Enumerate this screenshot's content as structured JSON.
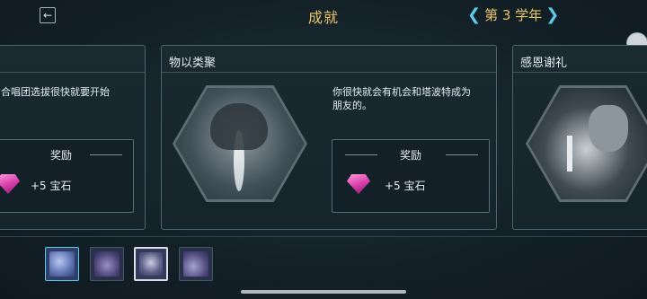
{
  "header": {
    "back_icon": "back-arrow-icon",
    "title": "成就",
    "year_label": "第 3 学年",
    "prev_icon": "chevron-left-icon",
    "next_icon": "chevron-right-icon"
  },
  "cards": {
    "left": {
      "desc": "合唱团选拔很快就要开始",
      "reward_label": "奖励",
      "reward_value": "+5 宝石"
    },
    "center": {
      "title": "物以类聚",
      "desc_line1": "你很快就会有机会和塔波特成为",
      "desc_line2": "朋友的。",
      "reward_label": "奖励",
      "reward_value": "+5 宝石"
    },
    "right": {
      "title": "感恩谢礼"
    }
  },
  "colors": {
    "accent_gold": "#e9c46a",
    "accent_cyan": "#5fc9e8",
    "gem_pink": "#d33aa8"
  }
}
